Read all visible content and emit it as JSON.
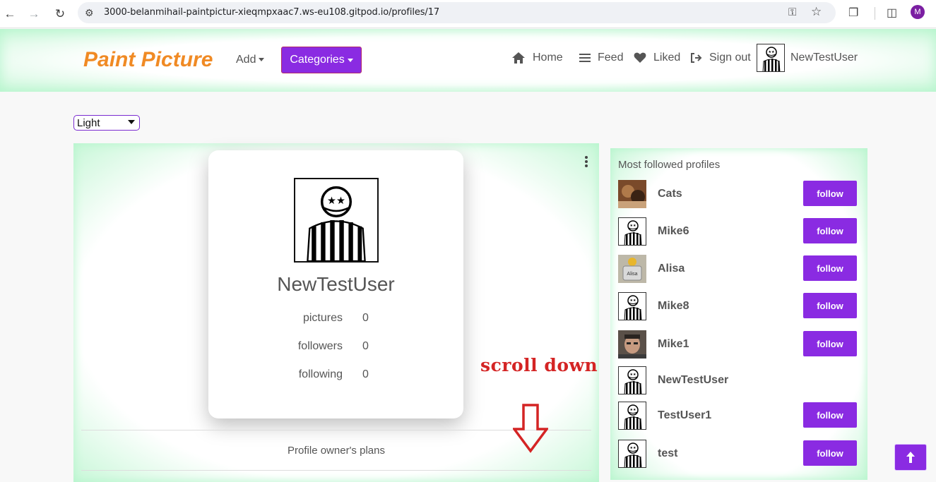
{
  "browser": {
    "url": "3000-belanmihail-paintpictur-xieqmpxaac7.ws-eu108.gitpod.io/profiles/17",
    "profile_initial": "M"
  },
  "header": {
    "brand": "Paint Picture",
    "add_label": "Add",
    "categories_label": "Categories",
    "nav": {
      "home": "Home",
      "feed": "Feed",
      "liked": "Liked",
      "signout": "Sign out",
      "username": "NewTestUser"
    }
  },
  "theme": {
    "selected": "Light"
  },
  "profile": {
    "name": "NewTestUser",
    "stats": [
      {
        "label": "pictures",
        "value": "0"
      },
      {
        "label": "followers",
        "value": "0"
      },
      {
        "label": "following",
        "value": "0"
      }
    ],
    "plans_label": "Profile owner's plans"
  },
  "annotation": {
    "scroll_hint": "scroll down"
  },
  "sidebar": {
    "title": "Most followed profiles",
    "profiles": [
      {
        "name": "Cats",
        "avatar": "cat-photo",
        "follow": "follow"
      },
      {
        "name": "Mike6",
        "avatar": "striped-figure",
        "follow": "follow"
      },
      {
        "name": "Alisa",
        "avatar": "alisa-badge",
        "follow": "follow"
      },
      {
        "name": "Mike8",
        "avatar": "striped-figure",
        "follow": "follow"
      },
      {
        "name": "Mike1",
        "avatar": "man-photo",
        "follow": "follow"
      },
      {
        "name": "NewTestUser",
        "avatar": "striped-figure",
        "follow": ""
      },
      {
        "name": "TestUser1",
        "avatar": "striped-figure",
        "follow": "follow"
      },
      {
        "name": "test",
        "avatar": "striped-figure",
        "follow": "follow"
      }
    ]
  },
  "colors": {
    "accent": "#8a2be2",
    "brand": "#f08a24",
    "hint": "#d42424"
  }
}
